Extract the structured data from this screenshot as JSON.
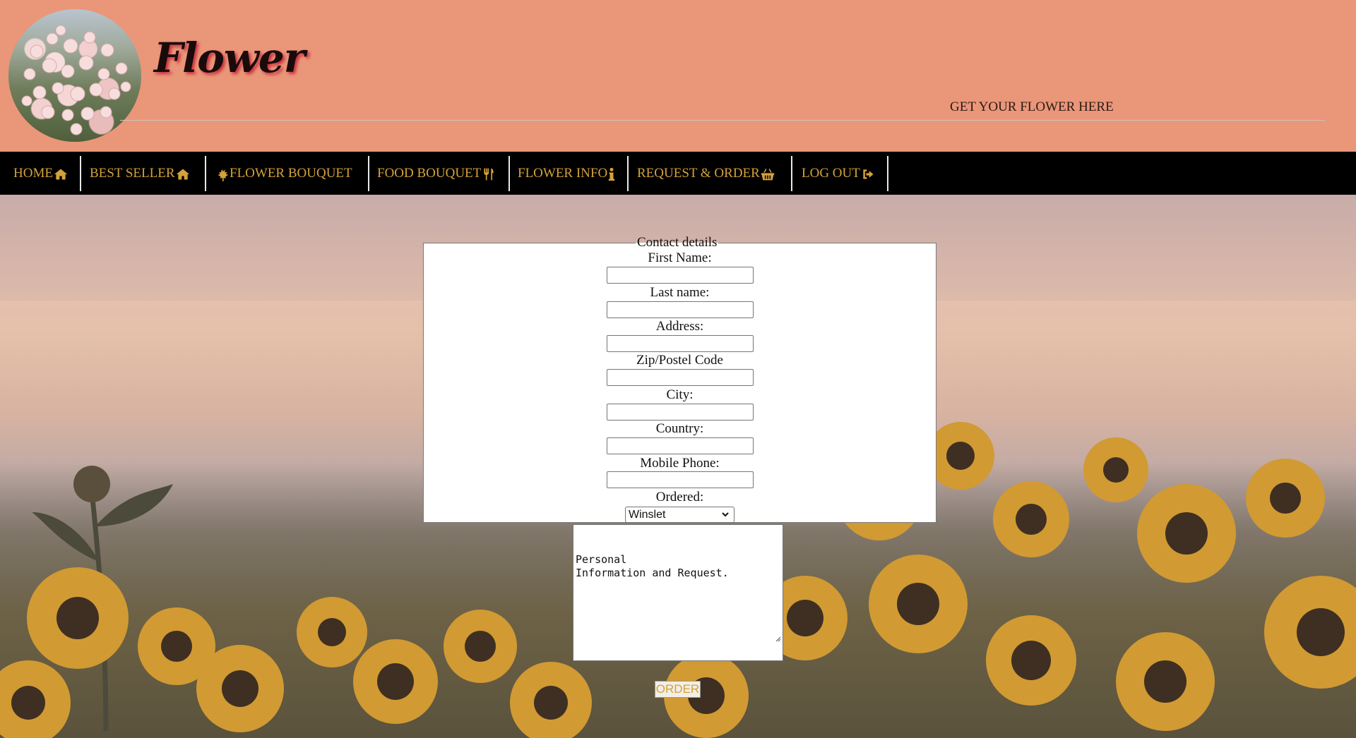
{
  "header": {
    "brand": "Flower",
    "tagline": "GET YOUR FLOWER HERE"
  },
  "nav": {
    "items": [
      {
        "label": "HOME",
        "icon": "home-icon"
      },
      {
        "label": "BEST SELLER",
        "icon": "home-icon"
      },
      {
        "label": "FLOWER BOUQUET",
        "icon": "leaf-icon"
      },
      {
        "label": "FOOD BOUQUET",
        "icon": "utensils-icon"
      },
      {
        "label": "FLOWER INFO",
        "icon": "info-icon"
      },
      {
        "label": "REQUEST & ORDER",
        "icon": "basket-icon"
      },
      {
        "label": "LOG OUT",
        "icon": "sign-out-icon"
      }
    ]
  },
  "form": {
    "legend": "Contact details",
    "fields": [
      {
        "label": "First Name:",
        "value": ""
      },
      {
        "label": "Last name:",
        "value": ""
      },
      {
        "label": "Address:",
        "value": ""
      },
      {
        "label": "Zip/Postel Code",
        "value": ""
      },
      {
        "label": "City:",
        "value": ""
      },
      {
        "label": "Country:",
        "value": ""
      },
      {
        "label": "Mobile Phone:",
        "value": ""
      }
    ],
    "ordered_label": "Ordered:",
    "ordered_value": "Winslet",
    "textarea_value": "                        Personal\nInformation and Request.",
    "submit_label": "ORDER"
  },
  "colors": {
    "header_bg": "#ea9679",
    "nav_bg": "#000000",
    "nav_text": "#d4a23a",
    "brand_shadow": "#c9303e"
  }
}
